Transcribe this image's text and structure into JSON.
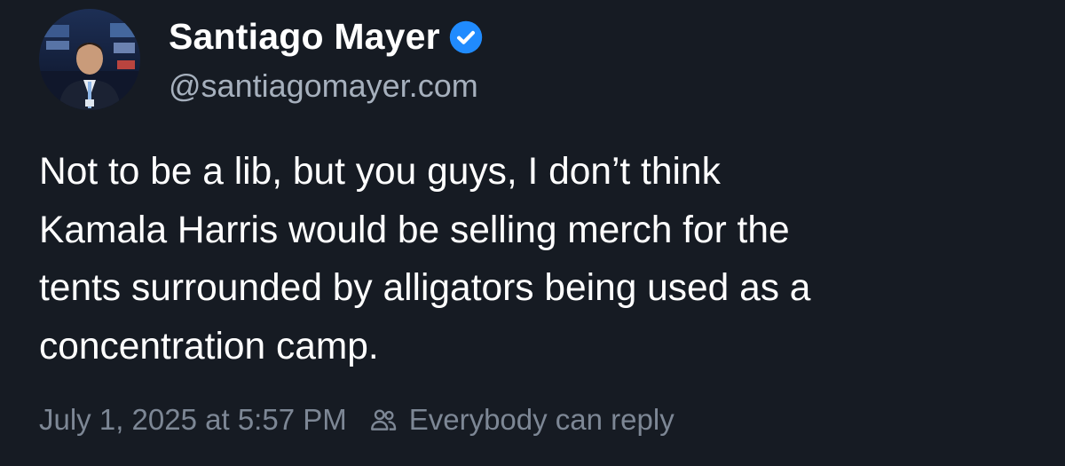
{
  "author": {
    "display_name": "Santiago Mayer",
    "handle": "@santiagomayer.com",
    "verified": true,
    "avatar_icon": "profile-photo"
  },
  "post": {
    "text": "Not to be a lib, but you guys, I don’t think\nKamala Harris would be selling merch for the\ntents surrounded by alligators being used as a\nconcentration camp."
  },
  "meta": {
    "timestamp": "July 1, 2025 at 5:57 PM",
    "reply_setting_icon": "people-icon",
    "reply_setting": "Everybody can reply"
  },
  "colors": {
    "background": "#161b23",
    "text": "#ffffff",
    "secondary_text": "#a6b0bd",
    "meta_text": "#7d8795",
    "verified_badge": "#208bfe"
  }
}
